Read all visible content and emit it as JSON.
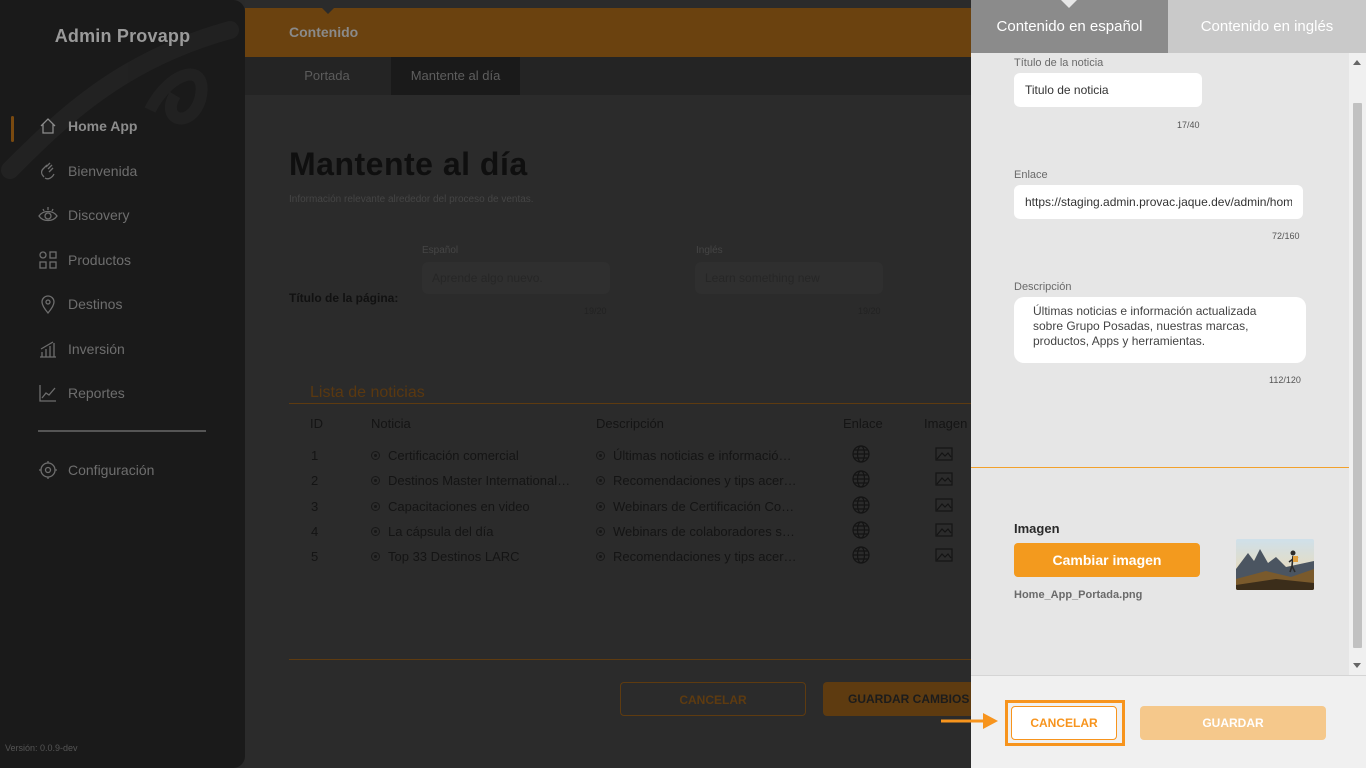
{
  "sidebar": {
    "brand": "Admin Provapp",
    "items": [
      {
        "label": "Home App",
        "icon": "home-icon"
      },
      {
        "label": "Bienvenida",
        "icon": "wave-hand-icon"
      },
      {
        "label": "Discovery",
        "icon": "eye-icon"
      },
      {
        "label": "Productos",
        "icon": "grid-icon"
      },
      {
        "label": "Destinos",
        "icon": "map-pin-icon"
      },
      {
        "label": "Inversión",
        "icon": "bar-chart-icon"
      },
      {
        "label": "Reportes",
        "icon": "line-chart-icon"
      }
    ],
    "settings": {
      "label": "Configuración",
      "icon": "gear-icon"
    },
    "version": "Versión: 0.0.9-dev"
  },
  "main": {
    "header": "Contenido",
    "tabs": [
      "Portada",
      "Mantente al día"
    ],
    "title": "Mantente al día",
    "subtitle": "Información relevante alrededor del proceso de ventas.",
    "page_title_label": "Título de la página:",
    "es_label": "Español",
    "en_label": "Inglés",
    "es_value": "Aprende algo nuevo.",
    "en_value": "Learn something new",
    "es_count": "19/20",
    "en_count": "19/20",
    "list_title": "Lista de noticias",
    "columns": [
      "ID",
      "Noticia",
      "Descripción",
      "Enlace",
      "Imagen"
    ],
    "rows": [
      {
        "id": "1",
        "news": "Certificación comercial",
        "desc": "Últimas noticias e información actualizada"
      },
      {
        "id": "2",
        "news": "Destinos Master International Exclusivos",
        "desc": "Recomendaciones y tips acerca de destinos"
      },
      {
        "id": "3",
        "news": "Capacitaciones en video",
        "desc": "Webinars de Certificación Comercial"
      },
      {
        "id": "4",
        "news": "La cápsula del día",
        "desc": "Webinars de colaboradores sobre temas"
      },
      {
        "id": "5",
        "news": "Top 33 Destinos LARC",
        "desc": "Recomendaciones y tips acerca de destinos"
      }
    ],
    "cancel": "CANCELAR",
    "save": "GUARDAR CAMBIOS"
  },
  "panel": {
    "tabs": [
      "Contenido en español",
      "Contenido en inglés"
    ],
    "title_label": "Título de la noticia",
    "title_value": "Titulo de noticia",
    "title_count": "17/40",
    "link_label": "Enlace",
    "link_value": "https://staging.admin.provac.jaque.dev/admin/home",
    "link_count": "72/160",
    "desc_label": "Descripción",
    "desc_value": "Últimas noticias e información actualizada sobre Grupo Posadas, nuestras marcas, productos, Apps y herramientas.",
    "desc_count": "112/120",
    "image_label": "Imagen",
    "change_image": "Cambiar imagen",
    "filename": "Home_App_Portada.png",
    "cancel": "CANCELAR",
    "save": "GUARDAR"
  },
  "colors": {
    "accent": "#f7941d",
    "accent_light": "#f5c88b",
    "sidebar_bg": "#1a1a1a"
  }
}
